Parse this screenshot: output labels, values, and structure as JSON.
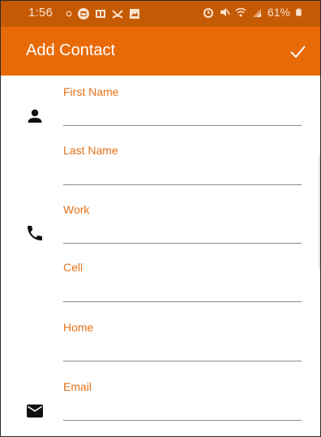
{
  "status_bar": {
    "time": "1:56",
    "battery": "61%",
    "icons_left": [
      "dot-icon",
      "calendar-icon",
      "notification-icon",
      "missed-call-icon",
      "image-icon"
    ],
    "icons_right": [
      "alarm-icon",
      "mute-icon",
      "wifi-icon",
      "signal-icon",
      "battery-icon"
    ]
  },
  "app_bar": {
    "title": "Add Contact",
    "confirm_icon": "check-icon"
  },
  "form": {
    "first_name": {
      "label": "First Name",
      "value": ""
    },
    "last_name": {
      "label": "Last Name",
      "value": ""
    },
    "work": {
      "label": "Work",
      "value": ""
    },
    "cell": {
      "label": "Cell",
      "value": ""
    },
    "home": {
      "label": "Home",
      "value": ""
    },
    "email": {
      "label": "Email",
      "value": ""
    }
  },
  "colors": {
    "status_bar": "#c55a05",
    "app_bar": "#e86a07",
    "label": "#e3731b",
    "underline": "#8a8a8a"
  }
}
